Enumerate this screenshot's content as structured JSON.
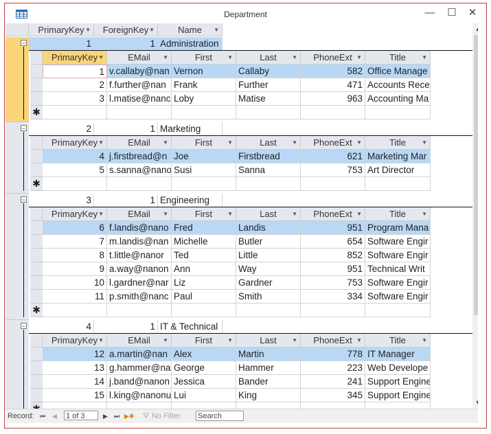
{
  "window": {
    "title": "Department",
    "minimize_glyph": "—",
    "maximize_glyph": "☐",
    "close_glyph": "✕"
  },
  "columns": {
    "primary_key": "PrimaryKey",
    "foreign_key": "ForeignKey",
    "name": "Name"
  },
  "sub_columns": {
    "primary_key": "PrimaryKey",
    "email": "EMail",
    "first": "First",
    "last": "Last",
    "phone_ext": "PhoneExt",
    "title": "Title"
  },
  "departments": [
    {
      "pk": "1",
      "fk": "1",
      "name": "Administration",
      "employees": [
        {
          "pk": "1",
          "email": "v.callaby@nan",
          "first": "Vernon",
          "last": "Callaby",
          "phone": "582",
          "title": "Office Manage"
        },
        {
          "pk": "2",
          "email": "f.further@nan",
          "first": "Frank",
          "last": "Further",
          "phone": "471",
          "title": "Accounts Rece"
        },
        {
          "pk": "3",
          "email": "l.matise@nanc",
          "first": "Loby",
          "last": "Matise",
          "phone": "963",
          "title": "Accounting Ma"
        }
      ]
    },
    {
      "pk": "2",
      "fk": "1",
      "name": "Marketing",
      "employees": [
        {
          "pk": "4",
          "email": "j.firstbread@n",
          "first": "Joe",
          "last": "Firstbread",
          "phone": "621",
          "title": "Marketing Mar"
        },
        {
          "pk": "5",
          "email": "s.sanna@nano",
          "first": "Susi",
          "last": "Sanna",
          "phone": "753",
          "title": "Art Director"
        }
      ]
    },
    {
      "pk": "3",
      "fk": "1",
      "name": "Engineering",
      "employees": [
        {
          "pk": "6",
          "email": "f.landis@nano",
          "first": "Fred",
          "last": "Landis",
          "phone": "951",
          "title": "Program Mana"
        },
        {
          "pk": "7",
          "email": "m.landis@nan",
          "first": "Michelle",
          "last": "Butler",
          "phone": "654",
          "title": "Software Engir"
        },
        {
          "pk": "8",
          "email": "t.little@nanor",
          "first": "Ted",
          "last": "Little",
          "phone": "852",
          "title": "Software Engir"
        },
        {
          "pk": "9",
          "email": "a.way@nanon",
          "first": "Ann",
          "last": "Way",
          "phone": "951",
          "title": "Technical Writ"
        },
        {
          "pk": "10",
          "email": "l.gardner@nar",
          "first": "Liz",
          "last": "Gardner",
          "phone": "753",
          "title": "Software Engir"
        },
        {
          "pk": "11",
          "email": "p.smith@nanc",
          "first": "Paul",
          "last": "Smith",
          "phone": "334",
          "title": "Software Engir"
        }
      ]
    },
    {
      "pk": "4",
      "fk": "1",
      "name": "IT & Technical",
      "employees": [
        {
          "pk": "12",
          "email": "a.martin@nan",
          "first": "Alex",
          "last": "Martin",
          "phone": "778",
          "title": "IT Manager"
        },
        {
          "pk": "13",
          "email": "g.hammer@nar",
          "first": "George",
          "last": "Hammer",
          "phone": "223",
          "title": "Web Develope"
        },
        {
          "pk": "14",
          "email": "j.band@nanon",
          "first": "Jessica",
          "last": "Bander",
          "phone": "241",
          "title": "Support Engine"
        },
        {
          "pk": "15",
          "email": "l.king@nanonu",
          "first": "Lui",
          "last": "King",
          "phone": "345",
          "title": "Support Engine"
        }
      ]
    }
  ],
  "new_row_glyph": "✱",
  "expand_glyph": "−",
  "navbar": {
    "record_label": "Record:",
    "position": "1 of 3",
    "no_filter": "No Filter",
    "search": "Search",
    "first_glyph": "⏮",
    "prev_glyph": "◀",
    "next_glyph": "▶",
    "last_glyph": "⏭",
    "new_glyph": "▶✱"
  },
  "colors": {
    "selected_row": "#b8d8f6",
    "current_record": "#fad57a",
    "header": "#e4e8ee",
    "window_border": "#c33b3b"
  }
}
